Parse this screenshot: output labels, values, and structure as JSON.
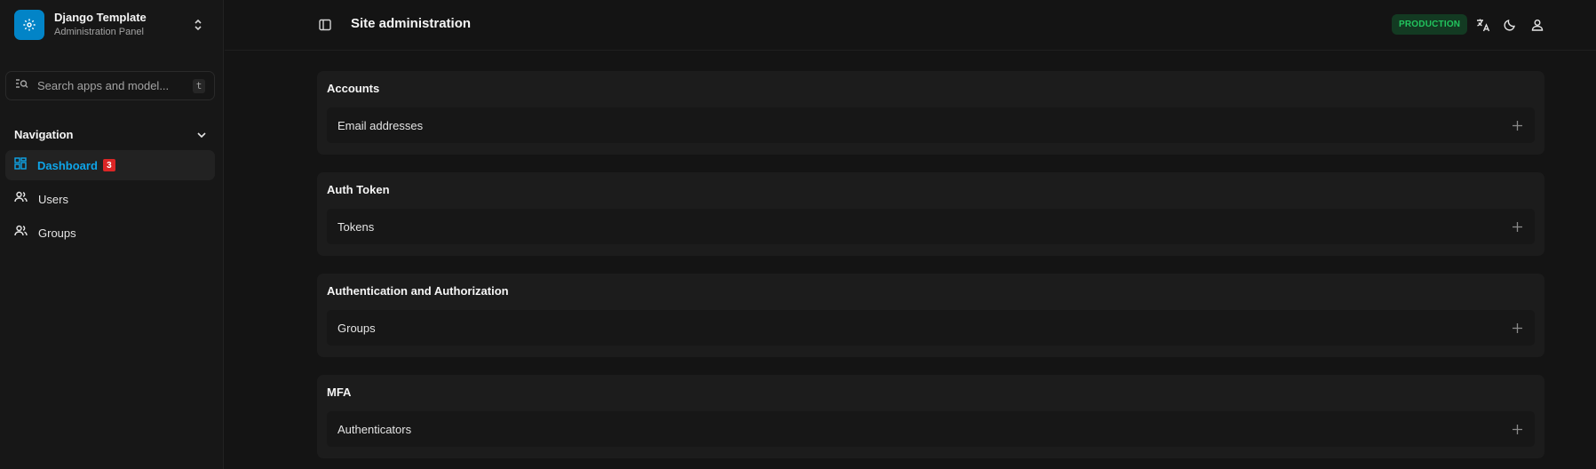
{
  "brand": {
    "title": "Django Template",
    "subtitle": "Administration Panel",
    "accent": "#0284c7"
  },
  "search": {
    "placeholder": "Search apps and model...",
    "shortcut": "t"
  },
  "nav": {
    "header": "Navigation",
    "items": [
      {
        "label": "Dashboard",
        "badge": "3",
        "active": true,
        "icon": "dashboard-icon"
      },
      {
        "label": "Users",
        "icon": "users-icon"
      },
      {
        "label": "Groups",
        "icon": "groups-icon"
      }
    ]
  },
  "header": {
    "title": "Site administration",
    "environment": "PRODUCTION",
    "icons": [
      "sidebar-toggle-icon",
      "translate-icon",
      "moon-icon",
      "user-icon"
    ]
  },
  "apps": [
    {
      "title": "Accounts",
      "models": [
        {
          "label": "Email addresses"
        }
      ]
    },
    {
      "title": "Auth Token",
      "models": [
        {
          "label": "Tokens"
        }
      ]
    },
    {
      "title": "Authentication and Authorization",
      "models": [
        {
          "label": "Groups"
        }
      ]
    },
    {
      "title": "MFA",
      "models": [
        {
          "label": "Authenticators"
        }
      ]
    }
  ],
  "colors": {
    "active_nav": "#0ea5e9",
    "badge": "#dc2626",
    "environment_text": "#22c55e",
    "environment_bg": "#133a22"
  }
}
